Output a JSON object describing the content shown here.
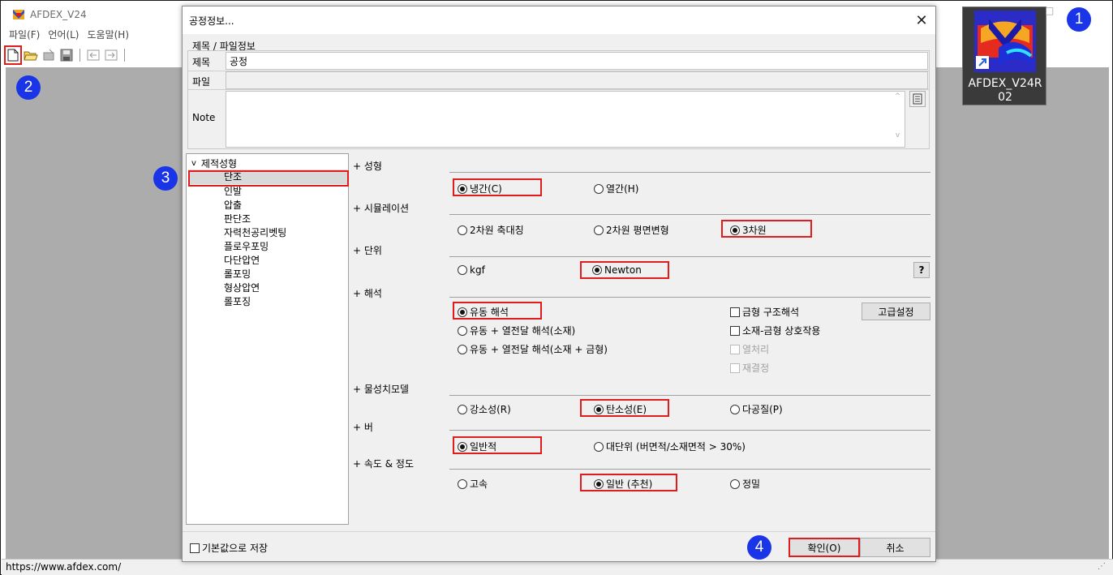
{
  "app": {
    "title": "AFDEX_V24",
    "menu": [
      "파일(F)",
      "언어(L)",
      "도움말(H)"
    ],
    "status_url": "https://www.afdex.com/"
  },
  "shortcut": {
    "label_line1": "AFDEX_V24R",
    "label_line2": "02"
  },
  "callouts": {
    "c1": "1",
    "c2": "2",
    "c3": "3",
    "c4": "4"
  },
  "dialog": {
    "title": "공정정보...",
    "close_glyph": "✕",
    "group_label": "제목 / 파일정보",
    "title_label": "제목",
    "title_value": "공정",
    "file_label": "파일",
    "file_value": "",
    "note_label": "Note",
    "tree": {
      "root": "제적성형",
      "items": [
        "단조",
        "인발",
        "압출",
        "판단조",
        "자력천공리벳팅",
        "플로우포밍",
        "다단압연",
        "롤포밍",
        "형상압연",
        "롤포징"
      ],
      "selected_index": 0
    },
    "sections": {
      "forming": "+ 성형",
      "simulation": "+ 시뮬레이션",
      "unit": "+ 단위",
      "analysis": "+ 해석",
      "material": "+ 물성치모델",
      "burr": "+ 버",
      "speed": "+ 속도 & 정도"
    },
    "forming_options": [
      "냉간(C)",
      "열간(H)"
    ],
    "forming_selected": 0,
    "sim_options": [
      "2차원 축대칭",
      "2차원 평면변형",
      "3차원"
    ],
    "sim_selected": 2,
    "unit_options": [
      "kgf",
      "Newton"
    ],
    "unit_selected": 1,
    "unit_help": "?",
    "analysis_options": [
      "유동 해석",
      "유동 + 열전달 해석(소재)",
      "유동 + 열전달 해석(소재 + 금형)"
    ],
    "analysis_selected": 0,
    "analysis_checks": [
      {
        "label": "금형 구조해석",
        "checked": false,
        "disabled": false
      },
      {
        "label": "소재-금형 상호작용",
        "checked": false,
        "disabled": false
      },
      {
        "label": "열처리",
        "checked": false,
        "disabled": true
      },
      {
        "label": "재결정",
        "checked": false,
        "disabled": true
      }
    ],
    "advanced_button": "고급설정",
    "material_options": [
      "강소성(R)",
      "탄소성(E)",
      "다공질(P)"
    ],
    "material_selected": 1,
    "burr_options": [
      "일반적",
      "대단위 (버면적/소재면적 > 30%)"
    ],
    "burr_selected": 0,
    "speed_options": [
      "고속",
      "일반 (추천)",
      "정밀"
    ],
    "speed_selected": 1,
    "save_default_label": "기본값으로 저장",
    "ok_button": "확인(O)",
    "cancel_button": "취소"
  }
}
